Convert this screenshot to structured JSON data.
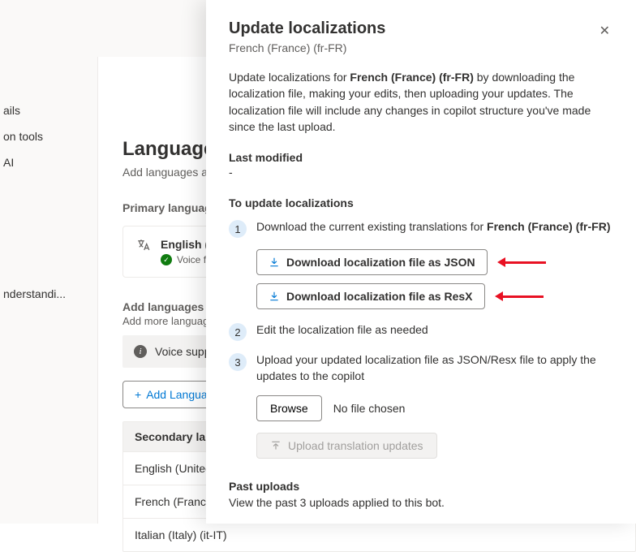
{
  "nav": {
    "items": [
      "ails",
      "on tools",
      "AI",
      "nderstandi..."
    ]
  },
  "languages": {
    "title": "Languages",
    "subtitle": "Add languages and c",
    "primary_heading": "Primary language",
    "primary_name": "English (Unit",
    "voice_label": "Voice feat",
    "add_heading": "Add languages",
    "add_sub": "Add more languages",
    "voice_support": "Voice support is",
    "add_button": "Add Langua",
    "sec_heading": "Secondary langua",
    "sec_rows": [
      "English (United Kin",
      "French (France) (fr-",
      "Italian (Italy) (it-IT)"
    ]
  },
  "panel": {
    "title": "Update localizations",
    "subtitle": "French (France) (fr-FR)",
    "desc_pre": "Update localizations for ",
    "desc_bold": "French (France) (fr-FR)",
    "desc_post": " by downloading the localization file, making your edits, then uploading your updates. The localization file will include any changes in copilot structure you've made since the last upload.",
    "last_modified_h": "Last modified",
    "last_modified_v": "-",
    "to_update_h": "To update localizations",
    "step1_pre": "Download the current existing translations for ",
    "step1_bold": "French (France) (fr-FR)",
    "dl_json": "Download localization file as JSON",
    "dl_resx": "Download localization file as ResX",
    "step2": "Edit the localization file as needed",
    "step3": "Upload your updated localization file as JSON/Resx file to apply the updates to the copilot",
    "browse": "Browse",
    "no_file": "No file chosen",
    "upload_btn": "Upload translation updates",
    "past_h": "Past uploads",
    "past_sub": "View the past 3 uploads applied to this bot."
  }
}
